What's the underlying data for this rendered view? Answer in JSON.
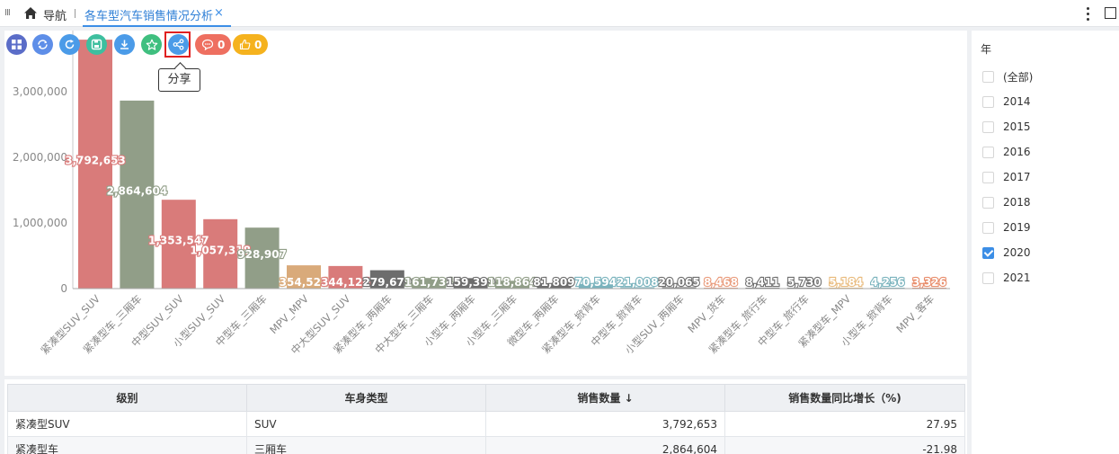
{
  "topbar": {
    "nav_label": "导航",
    "tab_title": "各车型汽车销售情况分析",
    "tab_close": "×"
  },
  "toolbar": {
    "buttons": [
      {
        "name": "grid-icon",
        "color": "#5b6dc8"
      },
      {
        "name": "sync-icon",
        "color": "#5e8ee8"
      },
      {
        "name": "refresh-icon",
        "color": "#4b9be8"
      },
      {
        "name": "save-icon",
        "color": "#3ebf9f"
      },
      {
        "name": "download-icon",
        "color": "#4b9be8"
      },
      {
        "name": "star-icon",
        "color": "#3fbf7f"
      },
      {
        "name": "share-icon",
        "color": "#4b9be8"
      }
    ],
    "comment_count": "0",
    "comment_color": "#ee6f60",
    "like_count": "0",
    "like_color": "#f5b21e",
    "tooltip": "分享"
  },
  "chart_data": {
    "type": "bar",
    "categories": [
      "紧凑型SUV_SUV",
      "紧凑型车_三厢车",
      "中型SUV_SUV",
      "小型SUV_SUV",
      "中型车_三厢车",
      "MPV_MPV",
      "中大型SUV_SUV",
      "紧凑型车_两厢车",
      "中大型车_三厢车",
      "小型车_两厢车",
      "小型车_三厢车",
      "微型车_两厢车",
      "紧凑型车_掀背车",
      "中型车_掀背车",
      "小型SUV_两厢车",
      "MPV_货车",
      "紧凑型车_旅行车",
      "中型车_旅行车",
      "紧凑型车_MPV",
      "小型车_掀背车",
      "MPV_客车"
    ],
    "values": [
      3792653,
      2864604,
      1353547,
      1057318,
      928907,
      354524,
      344124,
      279679,
      161734,
      159399,
      118864,
      81809,
      70594,
      21008,
      20065,
      8468,
      8411,
      5730,
      5184,
      4256,
      3326
    ],
    "value_labels": [
      "3,792,653",
      "2,864,604",
      "1,353,547",
      "1,057,318",
      "928,907",
      "354,524",
      "344,124",
      "279,679",
      "161,734",
      "159,399",
      "118,864",
      "81,809",
      "70,594",
      "21,008",
      "20,065",
      "8,468",
      "8,411",
      "5,730",
      "5,184",
      "4,256",
      "3,326"
    ],
    "colors": [
      "#d97b7a",
      "#919e88",
      "#d97b7a",
      "#d97b7a",
      "#919e88",
      "#d9aa7a",
      "#d97b7a",
      "#6d6d6d",
      "#919e88",
      "#6d6d6d",
      "#919e88",
      "#6d6d6d",
      "#7ab3bd",
      "#7ab3bd",
      "#6d6d6d",
      "#e99a7a",
      "#6d6d6d",
      "#6d6d6d",
      "#e8b97a",
      "#7ab3bd",
      "#e88c6a"
    ],
    "yticks": [
      0,
      1000000,
      2000000,
      3000000
    ],
    "ytick_labels": [
      "0",
      "1,000,000",
      "2,000,000",
      "3,000,000"
    ],
    "ylim": [
      0,
      4000000
    ],
    "grid": false,
    "legend": "none"
  },
  "filter": {
    "title": "年",
    "items": [
      {
        "label": "(全部)",
        "checked": false
      },
      {
        "label": "2014",
        "checked": false
      },
      {
        "label": "2015",
        "checked": false
      },
      {
        "label": "2016",
        "checked": false
      },
      {
        "label": "2017",
        "checked": false
      },
      {
        "label": "2018",
        "checked": false
      },
      {
        "label": "2019",
        "checked": false
      },
      {
        "label": "2020",
        "checked": true
      },
      {
        "label": "2021",
        "checked": false
      }
    ]
  },
  "table": {
    "headers": [
      "级别",
      "车身类型",
      "销售数量 ↓",
      "销售数量同比增长（%)"
    ],
    "rows": [
      [
        "紧凑型SUV",
        "SUV",
        "3,792,653",
        "27.95"
      ],
      [
        "紧凑型车",
        "三厢车",
        "2,864,604",
        "-21.98"
      ]
    ]
  }
}
